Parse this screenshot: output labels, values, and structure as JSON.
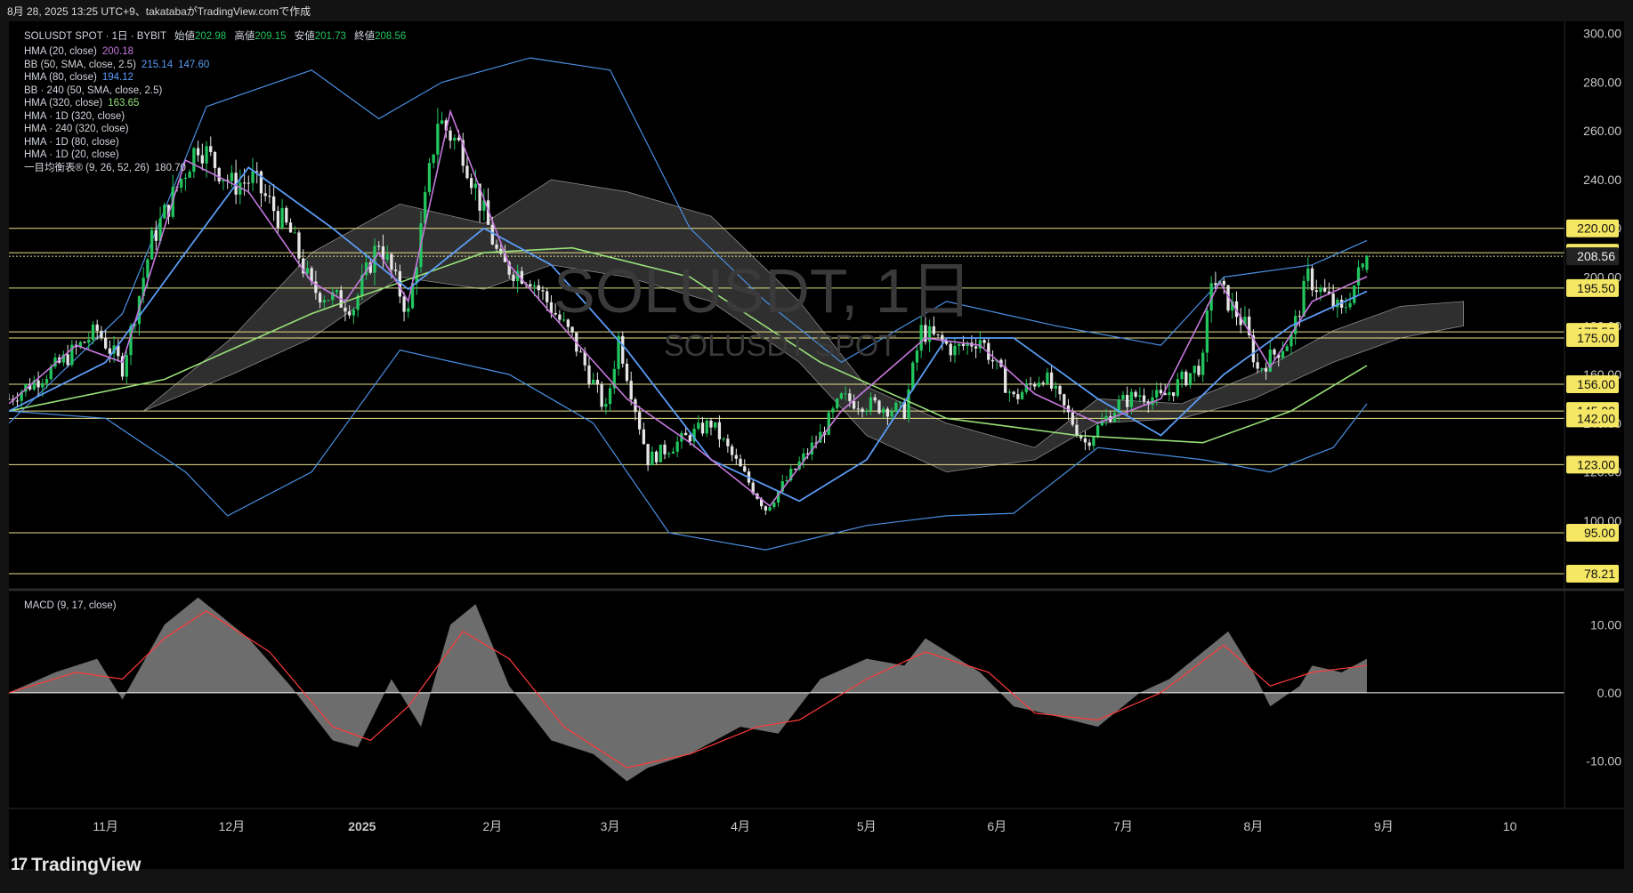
{
  "header": {
    "text": "8月 28, 2025 13:25 UTC+9、takatabaがTradingView.comで作成"
  },
  "watermark": {
    "title": "SOLUSDT, 1日",
    "subtitle": "SOLUSDT SPOT"
  },
  "legend": {
    "symbol_line": {
      "title": "SOLUSDT SPOT · 1日 · BYBIT",
      "open_label": "始値",
      "open": "202.98",
      "high_label": "高値",
      "high": "209.15",
      "low_label": "安値",
      "low": "201.73",
      "close_label": "終値",
      "close": "208.56"
    },
    "indicators": [
      {
        "label": "HMA (20, close)",
        "values": [
          "200.18"
        ],
        "colors": [
          "#c678dd"
        ]
      },
      {
        "label": "BB (50, SMA, close, 2.5)",
        "values": [
          "215.14",
          "147.60"
        ],
        "colors": [
          "#5b9cf6",
          "#5b9cf6"
        ]
      },
      {
        "label": "HMA (80, close)",
        "values": [
          "194.12"
        ],
        "colors": [
          "#5b9cf6"
        ]
      },
      {
        "label": "BB · 240 (50, SMA, close, 2.5)",
        "values": [],
        "colors": []
      },
      {
        "label": "HMA (320, close)",
        "values": [
          "163.65"
        ],
        "colors": [
          "#98e07a"
        ]
      },
      {
        "label": "HMA · 1D (320, close)",
        "values": [],
        "colors": []
      },
      {
        "label": "HMA · 240 (320, close)",
        "values": [],
        "colors": []
      },
      {
        "label": "HMA · 1D (80, close)",
        "values": [],
        "colors": []
      },
      {
        "label": "HMA · 1D (20, close)",
        "values": [],
        "colors": []
      },
      {
        "label": "一目均衡表® (9, 26, 52, 26)",
        "values": [
          "180.70"
        ],
        "colors": [
          "#d1d4dc"
        ]
      }
    ],
    "macd_label": "MACD (9, 17, close)"
  },
  "footer": {
    "logo_mark": "17",
    "brand": "TradingView"
  },
  "colors": {
    "up": "#22c55e",
    "down": "#e6e6e6",
    "bb": "#4a90e2",
    "hma20": "#c678dd",
    "hma80": "#5b9cf6",
    "hma320": "#98e07a",
    "hline": "#e8e08a",
    "badge": "#f5e663",
    "cloud": "#555555",
    "macd_fill": "#808080",
    "signal": "#ff3b3b"
  },
  "chart_data": {
    "type": "candlestick",
    "symbol": "SOLUSDT SPOT",
    "interval": "1日",
    "exchange": "BYBIT",
    "y_axis": {
      "range": [
        72,
        305
      ],
      "ticks": [
        100,
        120,
        140,
        160,
        180,
        200,
        220,
        240,
        260,
        280,
        300
      ],
      "tick_labels": [
        "100.00",
        "120.00",
        "140.00",
        "160.00",
        "180.00",
        "200.00",
        "220.00",
        "240.00",
        "260.00",
        "280.00",
        "300.00"
      ]
    },
    "x_axis": {
      "start_date": "2024-10-09",
      "end_date": "2025-10-14",
      "labels": [
        {
          "date": "2024-11-01",
          "text": "11月"
        },
        {
          "date": "2024-12-01",
          "text": "12月"
        },
        {
          "date": "2025-01-01",
          "text": "2025"
        },
        {
          "date": "2025-02-01",
          "text": "2月"
        },
        {
          "date": "2025-03-01",
          "text": "3月"
        },
        {
          "date": "2025-04-01",
          "text": "4月"
        },
        {
          "date": "2025-05-01",
          "text": "5月"
        },
        {
          "date": "2025-06-01",
          "text": "6月"
        },
        {
          "date": "2025-07-01",
          "text": "7月"
        },
        {
          "date": "2025-08-01",
          "text": "8月"
        },
        {
          "date": "2025-09-01",
          "text": "9月"
        },
        {
          "date": "2025-10-01",
          "text": "10"
        }
      ]
    },
    "price_path": [
      [
        "2024-10-09",
        150
      ],
      [
        "2024-10-20",
        163
      ],
      [
        "2024-10-30",
        178
      ],
      [
        "2024-11-05",
        163
      ],
      [
        "2024-11-12",
        215
      ],
      [
        "2024-11-23",
        255
      ],
      [
        "2024-12-01",
        238
      ],
      [
        "2024-12-06",
        240
      ],
      [
        "2024-12-15",
        218
      ],
      [
        "2024-12-20",
        195
      ],
      [
        "2024-12-30",
        188
      ],
      [
        "2025-01-05",
        215
      ],
      [
        "2025-01-12",
        185
      ],
      [
        "2025-01-19",
        265
      ],
      [
        "2025-01-25",
        252
      ],
      [
        "2025-02-03",
        205
      ],
      [
        "2025-02-10",
        200
      ],
      [
        "2025-02-20",
        175
      ],
      [
        "2025-02-28",
        145
      ],
      [
        "2025-03-03",
        175
      ],
      [
        "2025-03-10",
        125
      ],
      [
        "2025-03-25",
        140
      ],
      [
        "2025-04-07",
        105
      ],
      [
        "2025-04-20",
        135
      ],
      [
        "2025-04-25",
        150
      ],
      [
        "2025-05-10",
        145
      ],
      [
        "2025-05-14",
        178
      ],
      [
        "2025-05-22",
        170
      ],
      [
        "2025-05-28",
        175
      ],
      [
        "2025-06-05",
        150
      ],
      [
        "2025-06-12",
        160
      ],
      [
        "2025-06-22",
        132
      ],
      [
        "2025-06-30",
        148
      ],
      [
        "2025-07-05",
        152
      ],
      [
        "2025-07-10",
        150
      ],
      [
        "2025-07-20",
        165
      ],
      [
        "2025-07-22",
        200
      ],
      [
        "2025-07-30",
        180
      ],
      [
        "2025-08-02",
        162
      ],
      [
        "2025-08-10",
        175
      ],
      [
        "2025-08-14",
        200
      ],
      [
        "2025-08-22",
        185
      ],
      [
        "2025-08-28",
        208.56
      ]
    ],
    "last_bar": {
      "open": 202.98,
      "high": 209.15,
      "low": 201.73,
      "close": 208.56
    },
    "horizontal_levels": [
      220.0,
      210.0,
      208.56,
      195.5,
      177.5,
      175.0,
      156.0,
      145.0,
      142.0,
      123.0,
      95.0,
      78.21
    ],
    "level_labels": [
      "220.00",
      "210.00",
      "208.56",
      "195.50",
      "177.50",
      "175.00",
      "156.00",
      "145.00",
      "142.00",
      "123.00",
      "95.00",
      "78.21"
    ],
    "bb_upper": [
      [
        "2024-10-09",
        140
      ],
      [
        "2024-11-05",
        185
      ],
      [
        "2024-11-25",
        270
      ],
      [
        "2024-12-20",
        285
      ],
      [
        "2025-01-05",
        265
      ],
      [
        "2025-01-20",
        280
      ],
      [
        "2025-02-10",
        290
      ],
      [
        "2025-03-01",
        285
      ],
      [
        "2025-03-20",
        220
      ],
      [
        "2025-04-07",
        190
      ],
      [
        "2025-04-25",
        165
      ],
      [
        "2025-05-20",
        190
      ],
      [
        "2025-06-15",
        180
      ],
      [
        "2025-07-10",
        172
      ],
      [
        "2025-07-25",
        200
      ],
      [
        "2025-08-15",
        205
      ],
      [
        "2025-08-28",
        215
      ]
    ],
    "bb_lower": [
      [
        "2024-10-09",
        145
      ],
      [
        "2024-11-01",
        142
      ],
      [
        "2024-11-20",
        120
      ],
      [
        "2024-11-30",
        102
      ],
      [
        "2024-12-20",
        120
      ],
      [
        "2025-01-10",
        170
      ],
      [
        "2025-02-05",
        160
      ],
      [
        "2025-02-25",
        140
      ],
      [
        "2025-03-15",
        95
      ],
      [
        "2025-04-07",
        88
      ],
      [
        "2025-05-01",
        98
      ],
      [
        "2025-05-20",
        102
      ],
      [
        "2025-06-05",
        103
      ],
      [
        "2025-06-25",
        130
      ],
      [
        "2025-07-20",
        125
      ],
      [
        "2025-08-05",
        120
      ],
      [
        "2025-08-20",
        130
      ],
      [
        "2025-08-28",
        148
      ]
    ],
    "hma20": [
      [
        "2024-10-09",
        148
      ],
      [
        "2024-10-25",
        172
      ],
      [
        "2024-11-05",
        165
      ],
      [
        "2024-11-20",
        248
      ],
      [
        "2024-12-05",
        235
      ],
      [
        "2024-12-20",
        198
      ],
      [
        "2024-12-28",
        190
      ],
      [
        "2025-01-05",
        210
      ],
      [
        "2025-01-12",
        190
      ],
      [
        "2025-01-22",
        268
      ],
      [
        "2025-02-05",
        205
      ],
      [
        "2025-02-20",
        175
      ],
      [
        "2025-03-05",
        150
      ],
      [
        "2025-03-20",
        132
      ],
      [
        "2025-04-08",
        106
      ],
      [
        "2025-04-25",
        145
      ],
      [
        "2025-05-15",
        175
      ],
      [
        "2025-05-28",
        172
      ],
      [
        "2025-06-10",
        152
      ],
      [
        "2025-06-25",
        140
      ],
      [
        "2025-07-10",
        150
      ],
      [
        "2025-07-24",
        198
      ],
      [
        "2025-08-05",
        163
      ],
      [
        "2025-08-15",
        190
      ],
      [
        "2025-08-28",
        200.18
      ]
    ],
    "hma80": [
      [
        "2024-10-09",
        145
      ],
      [
        "2024-11-01",
        165
      ],
      [
        "2024-11-20",
        210
      ],
      [
        "2024-12-05",
        245
      ],
      [
        "2024-12-25",
        220
      ],
      [
        "2025-01-12",
        195
      ],
      [
        "2025-01-30",
        220
      ],
      [
        "2025-02-15",
        205
      ],
      [
        "2025-03-05",
        170
      ],
      [
        "2025-03-25",
        125
      ],
      [
        "2025-04-15",
        108
      ],
      [
        "2025-05-01",
        125
      ],
      [
        "2025-05-20",
        175
      ],
      [
        "2025-06-05",
        175
      ],
      [
        "2025-06-25",
        150
      ],
      [
        "2025-07-10",
        135
      ],
      [
        "2025-07-25",
        160
      ],
      [
        "2025-08-10",
        180
      ],
      [
        "2025-08-28",
        194.12
      ]
    ],
    "hma320": [
      [
        "2024-10-09",
        145
      ],
      [
        "2024-11-15",
        158
      ],
      [
        "2024-12-20",
        185
      ],
      [
        "2025-01-30",
        210
      ],
      [
        "2025-02-20",
        212
      ],
      [
        "2025-03-20",
        200
      ],
      [
        "2025-04-20",
        165
      ],
      [
        "2025-05-20",
        142
      ],
      [
        "2025-06-20",
        135
      ],
      [
        "2025-07-20",
        132
      ],
      [
        "2025-08-10",
        145
      ],
      [
        "2025-08-28",
        163.65
      ]
    ],
    "ichimoku_cloud": [
      [
        "2024-11-10",
        145,
        145
      ],
      [
        "2024-12-01",
        175,
        160
      ],
      [
        "2024-12-20",
        210,
        175
      ],
      [
        "2025-01-10",
        230,
        200
      ],
      [
        "2025-01-30",
        222,
        195
      ],
      [
        "2025-02-15",
        240,
        205
      ],
      [
        "2025-03-05",
        235,
        200
      ],
      [
        "2025-03-25",
        225,
        190
      ],
      [
        "2025-04-15",
        190,
        165
      ],
      [
        "2025-05-01",
        155,
        135
      ],
      [
        "2025-05-20",
        140,
        120
      ],
      [
        "2025-06-10",
        130,
        125
      ],
      [
        "2025-06-25",
        150,
        140
      ],
      [
        "2025-07-15",
        148,
        142
      ],
      [
        "2025-08-01",
        160,
        150
      ],
      [
        "2025-08-20",
        178,
        165
      ],
      [
        "2025-09-05",
        188,
        175
      ],
      [
        "2025-09-20",
        190,
        180
      ]
    ],
    "macd": {
      "label": "MACD (9, 17, close)",
      "y_ticks": [
        10,
        0,
        -10
      ],
      "y_tick_labels": [
        "10.00",
        "0.00",
        "-10.00"
      ],
      "y_range": [
        -17,
        15
      ],
      "histogram": [
        [
          "2024-10-09",
          0
        ],
        [
          "2024-10-20",
          3
        ],
        [
          "2024-10-30",
          5
        ],
        [
          "2024-11-05",
          -1
        ],
        [
          "2024-11-15",
          10
        ],
        [
          "2024-11-23",
          14
        ],
        [
          "2024-12-05",
          8
        ],
        [
          "2024-12-15",
          1
        ],
        [
          "2024-12-25",
          -7
        ],
        [
          "2024-12-31",
          -8
        ],
        [
          "2025-01-08",
          2
        ],
        [
          "2025-01-15",
          -5
        ],
        [
          "2025-01-22",
          10
        ],
        [
          "2025-01-28",
          13
        ],
        [
          "2025-02-05",
          1
        ],
        [
          "2025-02-15",
          -7
        ],
        [
          "2025-02-25",
          -9
        ],
        [
          "2025-03-05",
          -13
        ],
        [
          "2025-03-10",
          -11
        ],
        [
          "2025-03-20",
          -9
        ],
        [
          "2025-04-01",
          -5
        ],
        [
          "2025-04-10",
          -6
        ],
        [
          "2025-04-20",
          2
        ],
        [
          "2025-05-01",
          5
        ],
        [
          "2025-05-10",
          4
        ],
        [
          "2025-05-15",
          8
        ],
        [
          "2025-05-28",
          3
        ],
        [
          "2025-06-05",
          -2
        ],
        [
          "2025-06-12",
          -3
        ],
        [
          "2025-06-25",
          -5
        ],
        [
          "2025-07-05",
          0
        ],
        [
          "2025-07-12",
          2
        ],
        [
          "2025-07-22",
          7
        ],
        [
          "2025-07-26",
          9
        ],
        [
          "2025-08-01",
          3
        ],
        [
          "2025-08-05",
          -2
        ],
        [
          "2025-08-12",
          1
        ],
        [
          "2025-08-15",
          4
        ],
        [
          "2025-08-22",
          3
        ],
        [
          "2025-08-28",
          5
        ]
      ],
      "signal": [
        [
          "2024-10-09",
          0
        ],
        [
          "2024-10-25",
          3
        ],
        [
          "2024-11-05",
          2
        ],
        [
          "2024-11-15",
          8
        ],
        [
          "2024-11-25",
          12
        ],
        [
          "2024-12-10",
          6
        ],
        [
          "2024-12-25",
          -5
        ],
        [
          "2025-01-03",
          -7
        ],
        [
          "2025-01-12",
          -2
        ],
        [
          "2025-01-25",
          9
        ],
        [
          "2025-02-05",
          5
        ],
        [
          "2025-02-18",
          -5
        ],
        [
          "2025-03-05",
          -11
        ],
        [
          "2025-03-20",
          -9
        ],
        [
          "2025-04-05",
          -5
        ],
        [
          "2025-04-15",
          -4
        ],
        [
          "2025-05-01",
          2
        ],
        [
          "2025-05-15",
          6
        ],
        [
          "2025-05-30",
          3
        ],
        [
          "2025-06-10",
          -3
        ],
        [
          "2025-06-25",
          -4
        ],
        [
          "2025-07-10",
          0
        ],
        [
          "2025-07-25",
          7
        ],
        [
          "2025-08-05",
          1
        ],
        [
          "2025-08-15",
          3
        ],
        [
          "2025-08-28",
          4
        ]
      ]
    }
  }
}
